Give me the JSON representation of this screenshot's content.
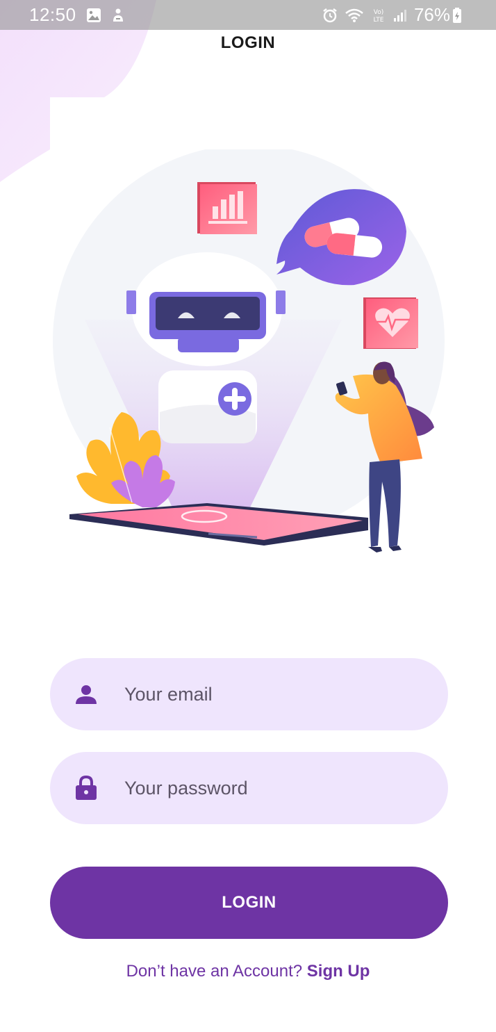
{
  "status_bar": {
    "time": "12:50",
    "battery": "76%",
    "icons_left": [
      "gallery-icon",
      "notification-icon"
    ],
    "icons_right": [
      "alarm-icon",
      "wifi-icon",
      "volte-icon",
      "signal-icon",
      "battery-charging-icon"
    ]
  },
  "header": {
    "title": "LOGIN"
  },
  "illustration": {
    "name": "medical-chatbot-illustration"
  },
  "form": {
    "email": {
      "placeholder": "Your email",
      "value": "",
      "icon": "person-icon"
    },
    "password": {
      "placeholder": "Your password",
      "value": "",
      "icon": "lock-icon"
    },
    "login_button": "LOGIN"
  },
  "footer": {
    "prompt": "Don’t have an Account?",
    "signup_link": "Sign Up"
  },
  "colors": {
    "primary": "#6e34a4",
    "field_background": "#efe5fd",
    "status_bar": "#9a9a9a"
  }
}
